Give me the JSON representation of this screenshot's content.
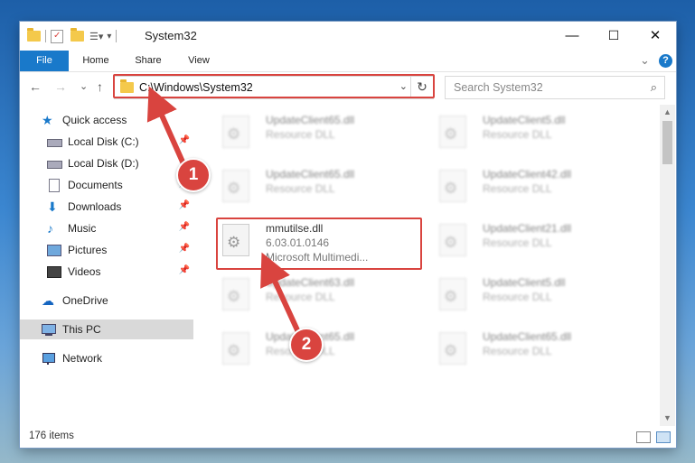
{
  "window": {
    "title": "System32",
    "minimize": "—",
    "maximize": "☐",
    "close": "✕"
  },
  "ribbon": {
    "tabs": [
      {
        "label": "File"
      },
      {
        "label": "Home"
      },
      {
        "label": "Share"
      },
      {
        "label": "View"
      }
    ],
    "expand": "⌄",
    "help": "?"
  },
  "address": {
    "path": "C:\\Windows\\System32",
    "back": "←",
    "forward": "→",
    "recent": "⌄",
    "up": "↑",
    "dropdown": "⌄",
    "refresh": "↻"
  },
  "search": {
    "placeholder": "Search System32",
    "icon": "⌕"
  },
  "nav": {
    "items": [
      {
        "label": "Quick access",
        "icon": "star-icon",
        "pin": ""
      },
      {
        "label": "Local Disk (C:)",
        "icon": "drive-icon",
        "pin": "📌"
      },
      {
        "label": "Local Disk (D:)",
        "icon": "drive-icon",
        "pin": ""
      },
      {
        "label": "Documents",
        "icon": "document-icon",
        "pin": "📌"
      },
      {
        "label": "Downloads",
        "icon": "download-icon",
        "pin": "📌"
      },
      {
        "label": "Music",
        "icon": "music-icon",
        "pin": "📌"
      },
      {
        "label": "Pictures",
        "icon": "picture-icon",
        "pin": "📌"
      },
      {
        "label": "Videos",
        "icon": "video-icon",
        "pin": "📌"
      },
      {
        "label": "OneDrive",
        "icon": "cloud-icon",
        "pin": ""
      },
      {
        "label": "This PC",
        "icon": "computer-icon",
        "pin": ""
      },
      {
        "label": "Network",
        "icon": "network-icon",
        "pin": ""
      }
    ]
  },
  "files": {
    "left": [
      {
        "name": "UpdateClient65.dll",
        "sub": "Resource DLL"
      },
      {
        "name": "UpdateClient65.dll",
        "sub": "Resource DLL"
      },
      {
        "name": "mmutilse.dll",
        "sub": "6.03.01.0146",
        "sub2": "Microsoft Multimedi..."
      },
      {
        "name": "UpdateClient63.dll",
        "sub": "Resource DLL"
      },
      {
        "name": "UpdateClient65.dll",
        "sub": "Resource DLL"
      }
    ],
    "right": [
      {
        "name": "UpdateClient5.dll",
        "sub": "Resource DLL"
      },
      {
        "name": "UpdateClient42.dll",
        "sub": "Resource DLL"
      },
      {
        "name": "UpdateClient21.dll",
        "sub": "Resource DLL"
      },
      {
        "name": "UpdateClient5.dll",
        "sub": "Resource DLL"
      },
      {
        "name": "UpdateClient65.dll",
        "sub": "Resource DLL"
      }
    ]
  },
  "status": {
    "count": "176 items"
  },
  "callouts": {
    "one": "1",
    "two": "2"
  },
  "colors": {
    "accent": "#1979ca",
    "highlight": "#d9443f"
  }
}
